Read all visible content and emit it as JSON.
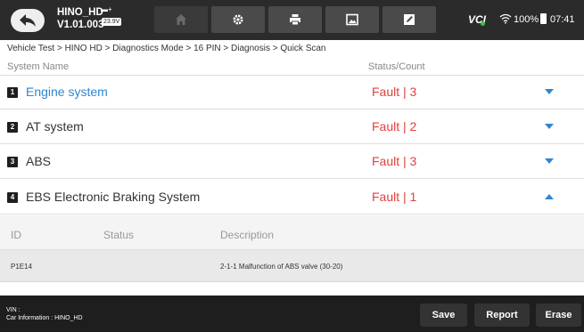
{
  "header": {
    "app_name": "HINO_HD",
    "version": "V1.01.003",
    "voltage": "23.9V",
    "vci_label": "VCI",
    "battery_percent": "100%",
    "time": "07:41"
  },
  "toolbar": {
    "icons": [
      "home-icon",
      "gear-icon",
      "printer-icon",
      "image-icon",
      "edit-icon"
    ]
  },
  "breadcrumb": "Vehicle Test > HINO HD > Diagnostics Mode > 16 PIN > Diagnosis > Quick Scan",
  "table": {
    "col_system": "System Name",
    "col_status": "Status/Count",
    "rows": [
      {
        "num": "1",
        "name": "Engine system",
        "status": "Fault | 3"
      },
      {
        "num": "2",
        "name": "AT system",
        "status": "Fault | 2"
      },
      {
        "num": "3",
        "name": "ABS",
        "status": "Fault | 3"
      },
      {
        "num": "4",
        "name": "EBS Electronic Braking System",
        "status": "Fault | 1"
      }
    ]
  },
  "detail": {
    "col_id": "ID",
    "col_status": "Status",
    "col_description": "Description",
    "rows": [
      {
        "id": "P1E14",
        "status": "",
        "description": "2-1-1 Malfunction of ABS valve (30-20)"
      }
    ]
  },
  "footer": {
    "vin_label": "VIN :",
    "car_info": "Car Information : HINO_HD",
    "save": "Save",
    "report": "Report",
    "erase": "Erase"
  },
  "colors": {
    "fault_red": "#e04040",
    "active_blue": "#2f86d1",
    "chevron_blue": "#2f86d1"
  }
}
